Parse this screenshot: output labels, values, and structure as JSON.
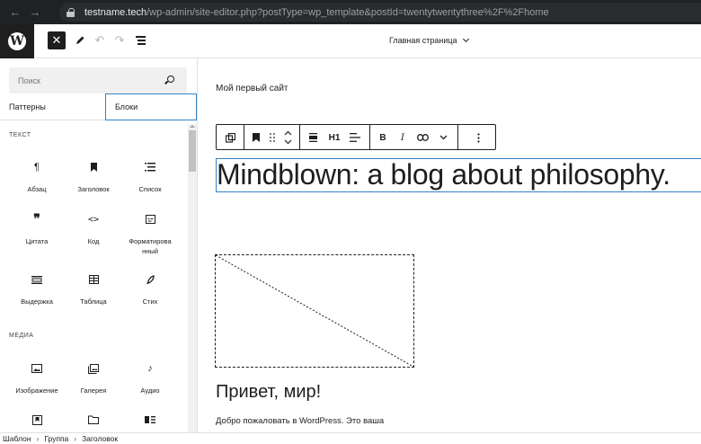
{
  "browser": {
    "url_domain": "testname.tech",
    "url_path": "/wp-admin/site-editor.php?postType=wp_template&postId=twentytwentythree%2F%2Fhome"
  },
  "header": {
    "logo_letter": "W",
    "close_glyph": "✕",
    "document_title": "Главная страница"
  },
  "sidebar": {
    "search_placeholder": "Поиск",
    "tabs": [
      {
        "label": "Паттерны"
      },
      {
        "label": "Блоки",
        "active": true
      }
    ],
    "categories": [
      {
        "label": "ТЕКСТ",
        "blocks": [
          {
            "label": "Абзац",
            "icon": "paragraph-icon"
          },
          {
            "label": "Заголовок",
            "icon": "heading-icon"
          },
          {
            "label": "Список",
            "icon": "list-icon"
          },
          {
            "label": "Цитата",
            "icon": "quote-icon"
          },
          {
            "label": "Код",
            "icon": "code-icon"
          },
          {
            "label": "Форматирова нный",
            "icon": "preformatted-icon"
          },
          {
            "label": "Выдержка",
            "icon": "pullquote-icon"
          },
          {
            "label": "Таблица",
            "icon": "table-icon"
          },
          {
            "label": "Стих",
            "icon": "verse-icon"
          }
        ]
      },
      {
        "label": "МЕДИА",
        "blocks": [
          {
            "label": "Изображение",
            "icon": "image-icon"
          },
          {
            "label": "Галерея",
            "icon": "gallery-icon"
          },
          {
            "label": "Аудио",
            "icon": "audio-icon"
          },
          {
            "label": "",
            "icon": "cover-icon"
          },
          {
            "label": "",
            "icon": "file-icon"
          },
          {
            "label": "",
            "icon": "media-text-icon"
          }
        ]
      }
    ]
  },
  "canvas": {
    "site_title": "Мой первый сайт",
    "heading_level": "H1",
    "heading_text": "Mindblown: a blog about philosophy.",
    "post_title": "Привет, мир!",
    "post_excerpt": "Добро пожаловать в WordPress. Это ваша"
  },
  "footer": {
    "breadcrumbs": [
      "Шаблон",
      "Группа",
      "Заголовок"
    ]
  },
  "colors": {
    "accent": "#3582c4",
    "dark": "#1e1e1e",
    "browser_bar": "#202124"
  }
}
